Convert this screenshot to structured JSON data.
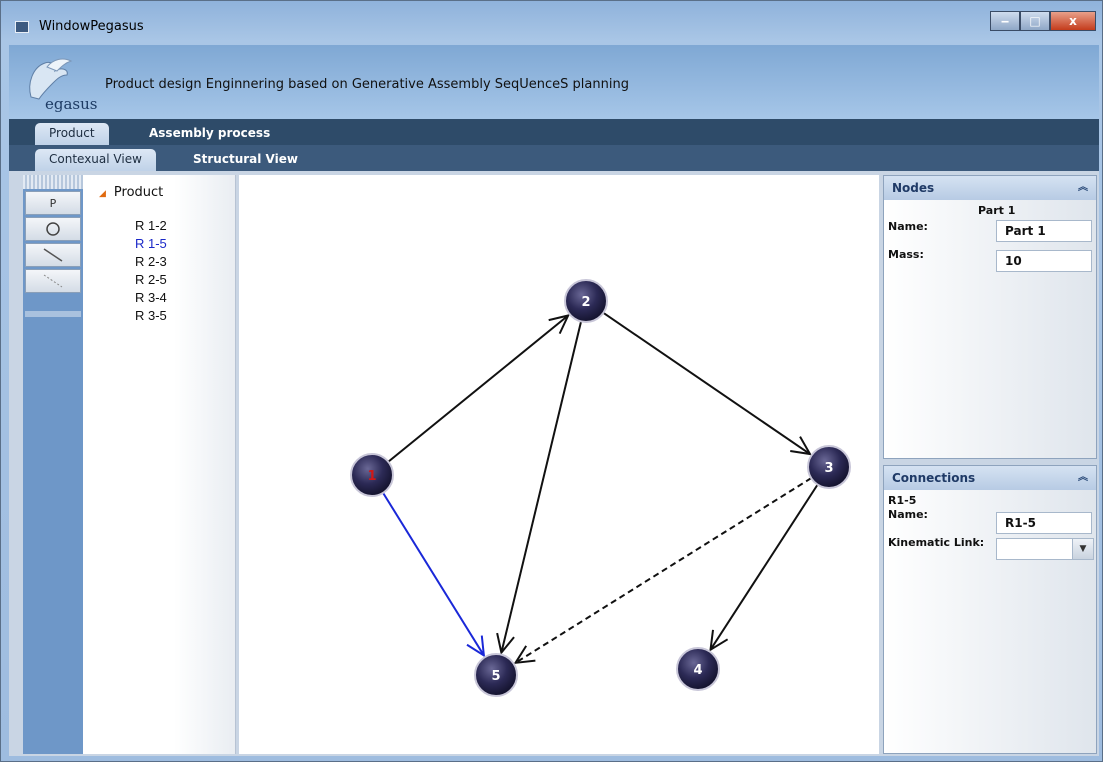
{
  "window": {
    "title": "WindowPegasus",
    "controls": {
      "minimize": "‒",
      "maximize": "□",
      "close": "x"
    }
  },
  "banner": {
    "logo_text": "egasus",
    "description": "Product design Enginnering based on Generative Assembly SeqUenceS planning"
  },
  "main_tabs": [
    {
      "label": "Product",
      "active": true
    },
    {
      "label": "Assembly process",
      "active": false
    }
  ],
  "view_tabs": [
    {
      "label": "Contexual View",
      "active": true
    },
    {
      "label": "Structural View",
      "active": false
    }
  ],
  "toolbox": {
    "tools": [
      "P",
      "circle-tool",
      "line-tool",
      "dashed-line-tool"
    ]
  },
  "tree": {
    "root": "Product",
    "items": [
      {
        "label": "R 1-2",
        "selected": false
      },
      {
        "label": "R 1-5",
        "selected": true
      },
      {
        "label": "R 2-3",
        "selected": false
      },
      {
        "label": "R 2-5",
        "selected": false
      },
      {
        "label": "R 3-4",
        "selected": false
      },
      {
        "label": "R 3-5",
        "selected": false
      }
    ]
  },
  "graph": {
    "nodes": [
      {
        "id": "1",
        "label": "1",
        "label_color": "#d01818"
      },
      {
        "id": "2",
        "label": "2",
        "label_color": "#ffffff"
      },
      {
        "id": "3",
        "label": "3",
        "label_color": "#ffffff"
      },
      {
        "id": "4",
        "label": "4",
        "label_color": "#ffffff"
      },
      {
        "id": "5",
        "label": "5",
        "label_color": "#ffffff"
      }
    ],
    "edges": [
      {
        "from": "1",
        "to": "2",
        "style": "solid",
        "color": "#111111"
      },
      {
        "from": "2",
        "to": "3",
        "style": "solid",
        "color": "#111111"
      },
      {
        "from": "2",
        "to": "5",
        "style": "solid",
        "color": "#111111"
      },
      {
        "from": "1",
        "to": "5",
        "style": "solid",
        "color": "#1a28d8"
      },
      {
        "from": "3",
        "to": "4",
        "style": "solid",
        "color": "#111111"
      },
      {
        "from": "3",
        "to": "5",
        "style": "dashed",
        "color": "#111111"
      }
    ]
  },
  "nodes_panel": {
    "header": "Nodes",
    "selected_title": "Part 1",
    "name_label": "Name:",
    "name_value": "Part 1",
    "mass_label": "Mass:",
    "mass_value": "10"
  },
  "connections_panel": {
    "header": "Connections",
    "selected_title": "R1-5",
    "name_label": "Name:",
    "name_value": "R1-5",
    "kinematic_label": "Kinematic Link:",
    "kinematic_value": ""
  }
}
